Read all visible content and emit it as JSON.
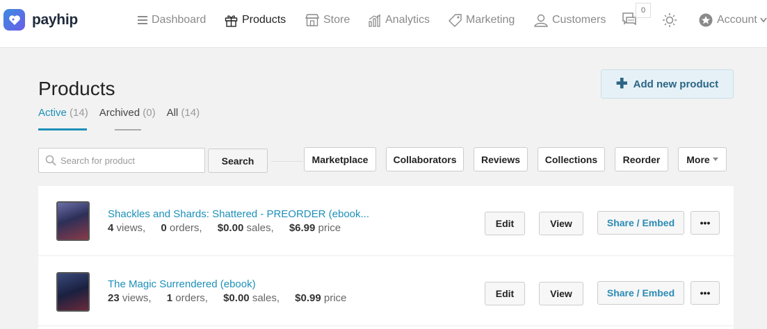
{
  "brand": {
    "name": "payhip",
    "accent": "#1d8fb8"
  },
  "nav": {
    "dashboard": "Dashboard",
    "products": "Products",
    "store": "Store",
    "analytics": "Analytics",
    "marketing": "Marketing",
    "customers": "Customers",
    "notifications_count": "0",
    "account": "Account"
  },
  "page": {
    "title": "Products",
    "add_button": "Add new product"
  },
  "tabs": [
    {
      "label": "Active",
      "count": "(14)"
    },
    {
      "label": "Archived",
      "count": "(0)"
    },
    {
      "label": "All",
      "count": "(14)"
    }
  ],
  "toolbar": {
    "search_placeholder": "Search for product",
    "search_button": "Search",
    "marketplace": "Marketplace",
    "collaborators": "Collaborators",
    "reviews": "Reviews",
    "collections": "Collections",
    "reorder": "Reorder",
    "more": "More"
  },
  "row_actions": {
    "edit": "Edit",
    "view": "View",
    "share": "Share / Embed",
    "menu": "•••"
  },
  "products": [
    {
      "title": "Shackles and Shards: Shattered - PREORDER (ebook...",
      "views": "4",
      "views_label": "views,",
      "orders": "0",
      "orders_label": "orders,",
      "sales": "$0.00",
      "sales_label": "sales,",
      "price": "$6.99",
      "price_label": "price"
    },
    {
      "title": "The Magic Surrendered (ebook)",
      "views": "23",
      "views_label": "views,",
      "orders": "1",
      "orders_label": "orders,",
      "sales": "$0.00",
      "sales_label": "sales,",
      "price": "$0.99",
      "price_label": "price"
    }
  ]
}
